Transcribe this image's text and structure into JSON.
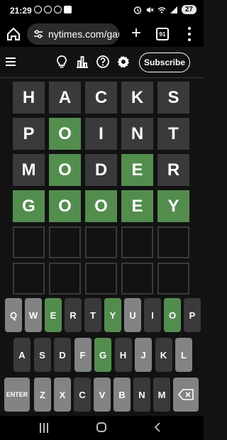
{
  "status_bar": {
    "time": "21:29",
    "battery": "27"
  },
  "browser": {
    "url": "nytimes.com/gam",
    "tab_count": "91"
  },
  "header": {
    "subscribe_label": "Subscribe"
  },
  "board": {
    "rows": [
      [
        {
          "letter": "H",
          "state": "absent"
        },
        {
          "letter": "A",
          "state": "absent"
        },
        {
          "letter": "C",
          "state": "absent"
        },
        {
          "letter": "K",
          "state": "absent"
        },
        {
          "letter": "S",
          "state": "absent"
        }
      ],
      [
        {
          "letter": "P",
          "state": "absent"
        },
        {
          "letter": "O",
          "state": "correct"
        },
        {
          "letter": "I",
          "state": "absent"
        },
        {
          "letter": "N",
          "state": "absent"
        },
        {
          "letter": "T",
          "state": "absent"
        }
      ],
      [
        {
          "letter": "M",
          "state": "absent"
        },
        {
          "letter": "O",
          "state": "correct"
        },
        {
          "letter": "D",
          "state": "absent"
        },
        {
          "letter": "E",
          "state": "correct"
        },
        {
          "letter": "R",
          "state": "absent"
        }
      ],
      [
        {
          "letter": "G",
          "state": "correct"
        },
        {
          "letter": "O",
          "state": "correct"
        },
        {
          "letter": "O",
          "state": "correct"
        },
        {
          "letter": "E",
          "state": "correct"
        },
        {
          "letter": "Y",
          "state": "correct"
        }
      ],
      [
        {
          "letter": "",
          "state": "empty"
        },
        {
          "letter": "",
          "state": "empty"
        },
        {
          "letter": "",
          "state": "empty"
        },
        {
          "letter": "",
          "state": "empty"
        },
        {
          "letter": "",
          "state": "empty"
        }
      ],
      [
        {
          "letter": "",
          "state": "empty"
        },
        {
          "letter": "",
          "state": "empty"
        },
        {
          "letter": "",
          "state": "empty"
        },
        {
          "letter": "",
          "state": "empty"
        },
        {
          "letter": "",
          "state": "empty"
        }
      ]
    ]
  },
  "keyboard": {
    "rows": [
      [
        {
          "label": "Q",
          "state": "unused"
        },
        {
          "label": "W",
          "state": "unused"
        },
        {
          "label": "E",
          "state": "correct"
        },
        {
          "label": "R",
          "state": "absent"
        },
        {
          "label": "T",
          "state": "absent"
        },
        {
          "label": "Y",
          "state": "correct"
        },
        {
          "label": "U",
          "state": "unused"
        },
        {
          "label": "I",
          "state": "absent"
        },
        {
          "label": "O",
          "state": "correct"
        },
        {
          "label": "P",
          "state": "absent"
        }
      ],
      [
        {
          "label": "A",
          "state": "absent"
        },
        {
          "label": "S",
          "state": "absent"
        },
        {
          "label": "D",
          "state": "absent"
        },
        {
          "label": "F",
          "state": "unused"
        },
        {
          "label": "G",
          "state": "correct"
        },
        {
          "label": "H",
          "state": "absent"
        },
        {
          "label": "J",
          "state": "unused"
        },
        {
          "label": "K",
          "state": "absent"
        },
        {
          "label": "L",
          "state": "unused"
        }
      ],
      [
        {
          "label": "ENTER",
          "state": "unused",
          "wide": true
        },
        {
          "label": "Z",
          "state": "unused"
        },
        {
          "label": "X",
          "state": "unused"
        },
        {
          "label": "C",
          "state": "absent"
        },
        {
          "label": "V",
          "state": "unused"
        },
        {
          "label": "B",
          "state": "unused"
        },
        {
          "label": "N",
          "state": "absent"
        },
        {
          "label": "M",
          "state": "absent"
        },
        {
          "label": "backspace-icon",
          "state": "unused",
          "wide": true,
          "icon": true
        }
      ]
    ]
  },
  "colors": {
    "correct": "#538d4e",
    "absent": "#3a3a3c",
    "unused": "#818384",
    "background": "#121213"
  }
}
